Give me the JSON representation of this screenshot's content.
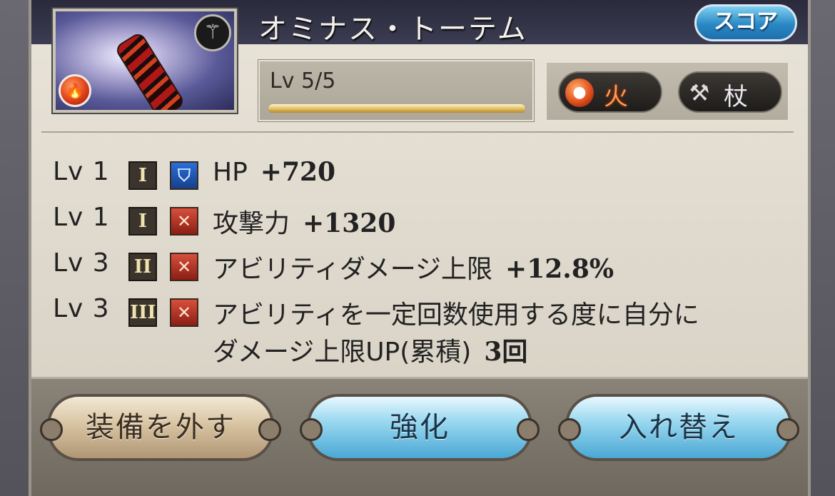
{
  "item": {
    "name": "オミナス・トーテム",
    "score_label": "スコア",
    "level": "Lv 5/5",
    "level_progress": 1.0,
    "element": {
      "label": "火",
      "icon": "fire-icon",
      "color": "#e0501c"
    },
    "weapon_type": {
      "label": "杖",
      "icon": "staff-icon"
    }
  },
  "skills": [
    {
      "lv": "Lv 1",
      "rank": "I",
      "type_icon": "hp-shield-icon",
      "desc": "HP",
      "value": "+720"
    },
    {
      "lv": "Lv 1",
      "rank": "I",
      "type_icon": "attack-swords-icon",
      "desc": "攻撃力",
      "value": "+1320"
    },
    {
      "lv": "Lv 3",
      "rank": "II",
      "type_icon": "attack-swords-icon",
      "desc": "アビリティダメージ上限",
      "value": "+12.8%"
    },
    {
      "lv": "Lv 3",
      "rank": "III",
      "type_icon": "attack-swords-icon",
      "desc": "アビリティを一定回数使用する度に自分に",
      "desc2": "ダメージ上限UP(累積)",
      "value": "3回"
    }
  ],
  "buttons": {
    "unequip": "装備を外す",
    "upgrade": "強化",
    "swap": "入れ替え"
  }
}
